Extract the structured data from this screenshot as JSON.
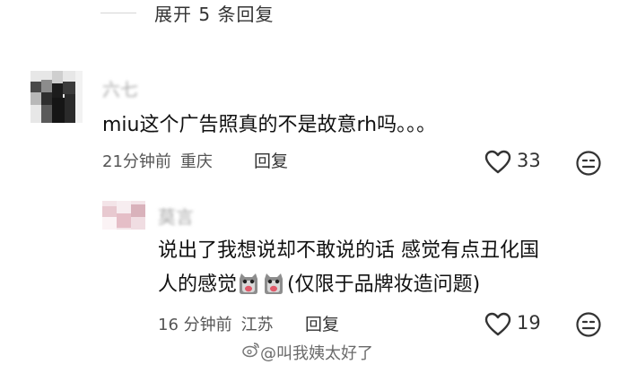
{
  "expand_replies": {
    "label": "展开 5 条回复"
  },
  "comments": [
    {
      "username": "六七",
      "text": "miu这个广告照真的不是故意rh吗。。。",
      "time": "21分钟前",
      "location": "重庆",
      "reply_label": "回复",
      "likes": "33"
    },
    {
      "username": "莫言",
      "text_line1": "说出了我想说却不敢说的话 感觉有点丑化国",
      "text_line2_prefix": "人的感觉",
      "text_line2_suffix": "(仅限于品牌妆造问题)",
      "time": "16 分钟前",
      "location": "江苏",
      "reply_label": "回复",
      "likes": "19"
    }
  ],
  "watermark": {
    "text": "@叫我姨太好了"
  },
  "icons": {
    "heart": "heart-icon",
    "emoji": "emoji-face-icon",
    "sticker": "crying-cat-sticker-icon",
    "weibo": "weibo-logo-icon"
  },
  "colors": {
    "text": "#111111",
    "meta": "#555555",
    "muted": "#aaaaaa"
  }
}
